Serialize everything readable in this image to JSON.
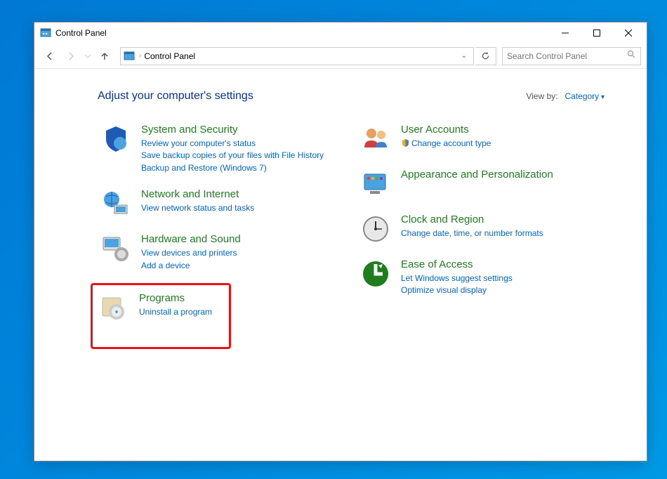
{
  "window": {
    "title": "Control Panel"
  },
  "breadcrumb": {
    "text": "Control Panel"
  },
  "search": {
    "placeholder": "Search Control Panel"
  },
  "header": {
    "title": "Adjust your computer's settings"
  },
  "viewby": {
    "label": "View by:",
    "value": "Category"
  },
  "left": [
    {
      "key": "system",
      "title": "System and Security",
      "links": [
        "Review your computer's status",
        "Save backup copies of your files with File History",
        "Backup and Restore (Windows 7)"
      ]
    },
    {
      "key": "network",
      "title": "Network and Internet",
      "links": [
        "View network status and tasks"
      ]
    },
    {
      "key": "hardware",
      "title": "Hardware and Sound",
      "links": [
        "View devices and printers",
        "Add a device"
      ]
    },
    {
      "key": "programs",
      "title": "Programs",
      "links": [
        "Uninstall a program"
      ],
      "highlighted": true
    }
  ],
  "right": [
    {
      "key": "user",
      "title": "User Accounts",
      "links": [
        "Change account type"
      ],
      "shield": [
        0
      ]
    },
    {
      "key": "appearance",
      "title": "Appearance and Personalization",
      "links": []
    },
    {
      "key": "clock",
      "title": "Clock and Region",
      "links": [
        "Change date, time, or number formats"
      ]
    },
    {
      "key": "ease",
      "title": "Ease of Access",
      "links": [
        "Let Windows suggest settings",
        "Optimize visual display"
      ]
    }
  ]
}
